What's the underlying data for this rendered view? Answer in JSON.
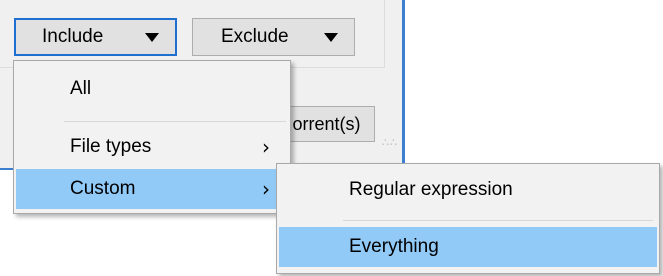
{
  "dialog": {
    "include_combo": {
      "label": "Include"
    },
    "exclude_combo": {
      "label": "Exclude"
    },
    "torrent_button": {
      "label": "orrent(s)"
    },
    "colors": {
      "accent": "#1e6fd0",
      "highlight": "#91c9f7"
    }
  },
  "menu": {
    "items": [
      {
        "label": "All"
      },
      {
        "label": "File types",
        "submenu_icon": "chevron-right-icon"
      },
      {
        "label": "Custom",
        "submenu_icon": "chevron-right-icon",
        "highlighted": true
      }
    ]
  },
  "submenu": {
    "items": [
      {
        "label": "Regular expression"
      },
      {
        "label": "Everything",
        "highlighted": true
      }
    ]
  }
}
